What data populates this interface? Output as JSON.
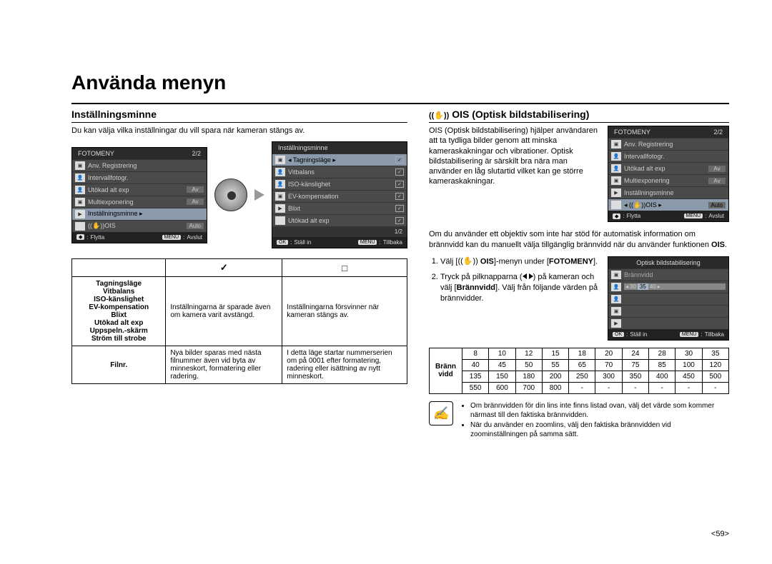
{
  "page_title": "Använda menyn",
  "page_number": "<59>",
  "left": {
    "heading": "Inställningsminne",
    "intro": "Du kan välja vilka inställningar du vill spara när kameran stängs av.",
    "cam1": {
      "title": "FOTOMENY",
      "page": "2/2",
      "rows": [
        {
          "label": "Anv. Registrering",
          "icon": "cam"
        },
        {
          "label": "Intervallfotogr.",
          "icon": "face1"
        },
        {
          "label": "Utökad alt exp",
          "icon": "face2",
          "val": "Av"
        },
        {
          "label": "Multiexponering",
          "icon": "cam",
          "val": "Av"
        },
        {
          "label": "Inställningsminne",
          "icon": "play",
          "sel": true,
          "arrow": true
        },
        {
          "label": "((✋))OIS",
          "icon": "",
          "val": "Auto"
        }
      ],
      "footer_l": "Flytta",
      "footer_r": "Avslut",
      "footer_r_btn": "MENU"
    },
    "cam2": {
      "title": "Inställningsminne",
      "rows": [
        {
          "label": "Tagningsläge",
          "icon": "cam",
          "sel": true,
          "check": true,
          "larrow": true,
          "rarrow": true
        },
        {
          "label": "Vitbalans",
          "icon": "face1",
          "check": true
        },
        {
          "label": "ISO-känslighet",
          "icon": "face2",
          "check": true
        },
        {
          "label": "EV-kompensation",
          "icon": "cam",
          "check": true
        },
        {
          "label": "Blixt",
          "icon": "play",
          "check": true
        },
        {
          "label": "Utökad alt exp",
          "icon": "",
          "check": true
        }
      ],
      "page": "1/2",
      "footer_l": "Ställ in",
      "footer_l_btn": "OK",
      "footer_r": "Tillbaka",
      "footer_r_btn": "MENU"
    },
    "table": {
      "col2_head": "✓",
      "col3_head": "□",
      "settings": [
        "Tagningsläge",
        "Vitbalans",
        "ISO-känslighet",
        "EV-kompensation",
        "Blixt",
        "Utökad alt exp",
        "Uppspeln.-skärm",
        "Ström till strobe"
      ],
      "col2_settings": "Inställningarna är sparade även om kamera varit avstängd.",
      "col3_settings": "Inställningarna försvinner när kameran stängs av.",
      "filnr_label": "Filnr.",
      "col2_filnr": "Nya bilder sparas med nästa filnummer även vid byta av minneskort, formatering eller radering.",
      "col3_filnr": "I detta läge startar nummerserien om på 0001 efter formatering, radering eller isättning av nytt minneskort."
    }
  },
  "right": {
    "heading": "((✋)) OIS (Optisk bildstabilisering)",
    "para1": "OIS (Optisk bildstabilisering) hjälper användaren att ta tydliga bilder genom att minska kameraskakningar och vibrationer. Optisk bildstabilisering är särskilt bra nära man använder en låg slutartid vilket kan ge större kameraskakningar.",
    "cam3": {
      "title": "FOTOMENY",
      "page": "2/2",
      "rows": [
        {
          "label": "Anv. Registrering",
          "icon": "cam"
        },
        {
          "label": "Intervallfotogr.",
          "icon": "face1"
        },
        {
          "label": "Utökad alt exp",
          "icon": "face2",
          "val": "Av"
        },
        {
          "label": "Multiexponering",
          "icon": "cam",
          "val": "Av"
        },
        {
          "label": "Inställningsminne",
          "icon": "play"
        },
        {
          "label": "((✋))OIS",
          "icon": "",
          "sel": true,
          "val": "Auto",
          "larrow": true,
          "rarrow": true
        }
      ],
      "footer_l": "Flytta",
      "footer_r": "Avslut",
      "footer_r_btn": "MENU"
    },
    "para2_a": "Om du använder ett objektiv som inte har stöd för automatisk information om brännvidd kan du manuellt välja tillgänglig brännvidd när du använder funktionen ",
    "para2_b": "OIS",
    "step1_a": "Välj [",
    "step1_b": " OIS",
    "step1_c": "]-menyn under [",
    "step1_d": "FOTOMENY",
    "step1_e": "].",
    "step2_a": "Tryck på pilknapparna (",
    "step2_b": ") på kameran och välj [",
    "step2_c": "Brännvidd",
    "step2_d": "]. Välj från följande värden på brännvidder.",
    "cam4": {
      "title": "Optisk bildstabilisering",
      "sub": "Brännvidd",
      "opts": [
        "30",
        "35",
        "40"
      ],
      "sel": 1,
      "footer_l": "Ställ in",
      "footer_l_btn": "OK",
      "footer_r": "Tillbaka",
      "footer_r_btn": "MENU"
    },
    "focal": {
      "label": "Bränn vidd",
      "rows": [
        [
          "8",
          "10",
          "12",
          "15",
          "18",
          "20",
          "24",
          "28",
          "30",
          "35"
        ],
        [
          "40",
          "45",
          "50",
          "55",
          "65",
          "70",
          "75",
          "85",
          "100",
          "120"
        ],
        [
          "135",
          "150",
          "180",
          "200",
          "250",
          "300",
          "350",
          "400",
          "450",
          "500"
        ],
        [
          "550",
          "600",
          "700",
          "800",
          "-",
          "-",
          "-",
          "-",
          "-",
          "-"
        ]
      ]
    },
    "note1": "Om brännvidden för din lins inte finns listad ovan, välj det värde som kommer närmast till den faktiska brännvidden.",
    "note2": "När du använder en zoomlins, välj den faktiska brännvidden vid zoominställningen på samma sätt."
  }
}
